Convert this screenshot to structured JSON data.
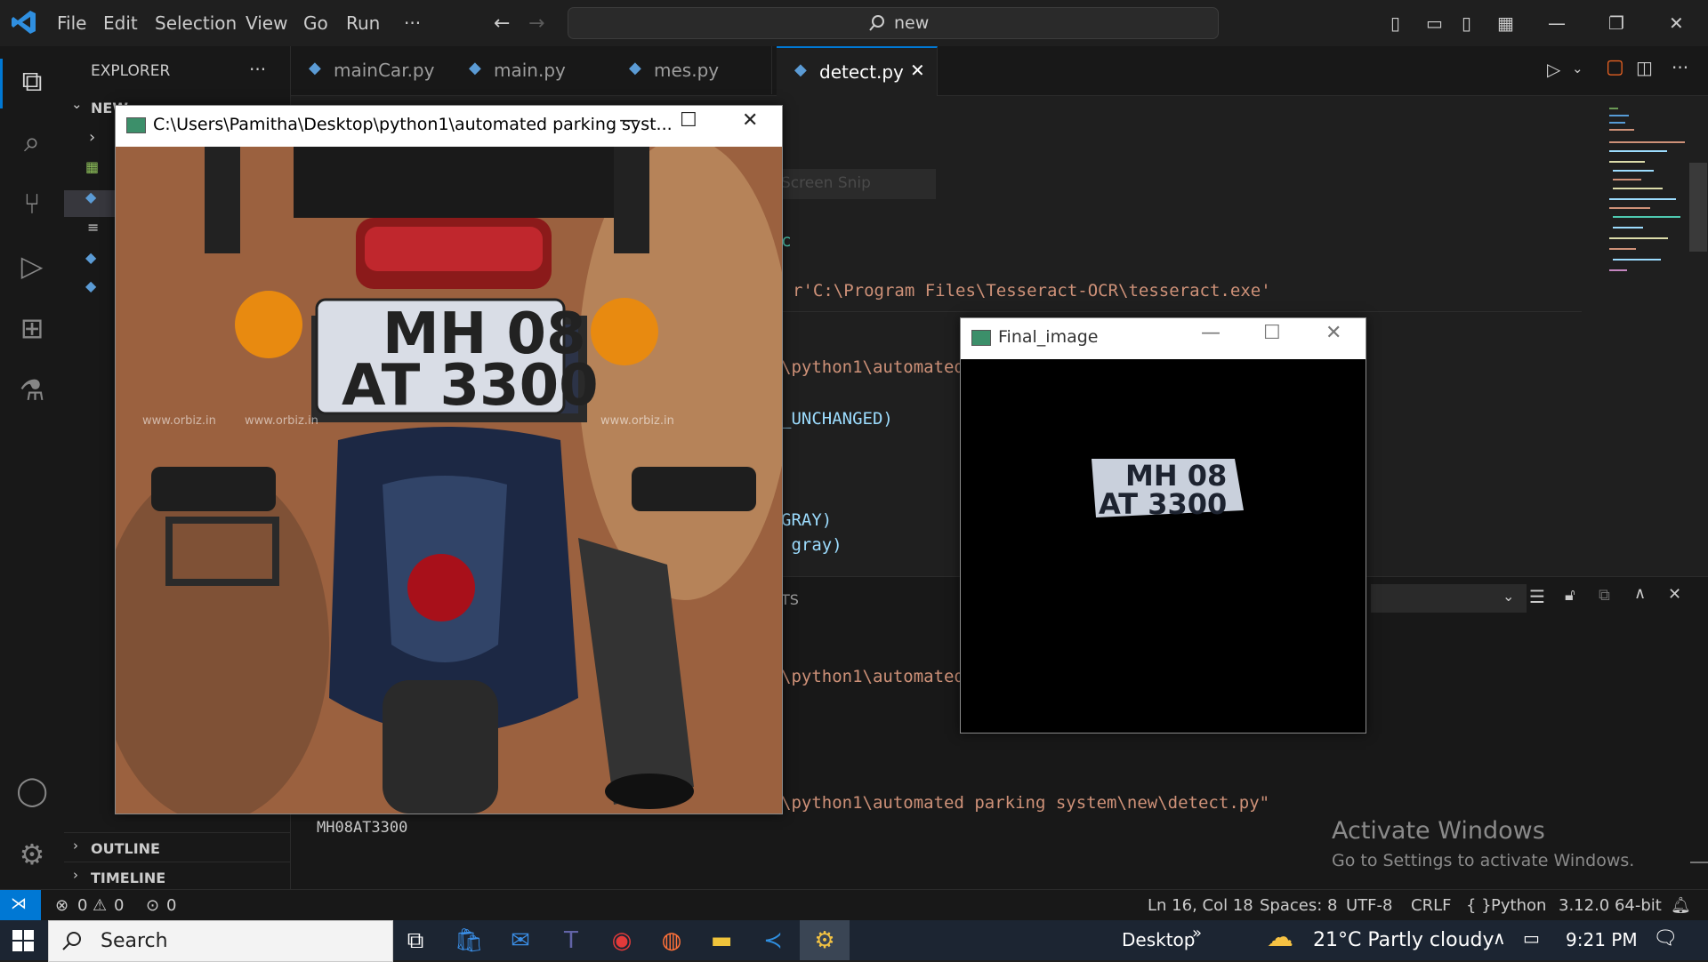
{
  "menu": [
    "File",
    "Edit",
    "Selection",
    "View",
    "Go",
    "Run",
    "···"
  ],
  "search": {
    "text": "new"
  },
  "sidebar": {
    "title": "EXPLORER",
    "more": "···",
    "folder": "NEW",
    "outline": "OUTLINE",
    "timeline": "TIMELINE"
  },
  "tabs": [
    {
      "label": "mainCar.py"
    },
    {
      "label": "main.py"
    },
    {
      "label": "mes.py"
    },
    {
      "label": "detect.py"
    }
  ],
  "editor": {
    "screen_snip": "Screen Snip",
    "lines": [
      "c",
      "r'C:\\Program Files\\Tesseract-OCR\\tesseract.exe'",
      "\\python1\\automated",
      "_UNCHANGED)",
      "GRAY)",
      " gray)"
    ]
  },
  "panel": {
    "tab_fragment": "TS",
    "terminal_lines": [
      "\\python1\\automated",
      "\\python1\\automated parking system\\new\\detect.py\"",
      "MH08AT3300"
    ]
  },
  "watermark": {
    "title": "Activate Windows",
    "subtitle": "Go to Settings to activate Windows."
  },
  "statusbar": {
    "errors": "0",
    "warnings": "0",
    "ports": "0",
    "position": "Ln 16, Col 18",
    "spaces": "Spaces: 8",
    "encoding": "UTF-8",
    "eol": "CRLF",
    "language": "Python",
    "interpreter": "3.12.0 64-bit"
  },
  "window1": {
    "title": "C:\\Users\\Pamitha\\Desktop\\python1\\automated parking syst...",
    "plate_line1": "MH 08",
    "plate_line2": "AT 3300",
    "watermark": "www.orbiz.in"
  },
  "window2": {
    "title": "Final_image",
    "plate_line1": "MH 08",
    "plate_line2": "AT 3300"
  },
  "taskbar": {
    "search": "Search",
    "desktop": "Desktop",
    "weather": "21°C  Partly cloudy",
    "time": "9:21 PM"
  }
}
